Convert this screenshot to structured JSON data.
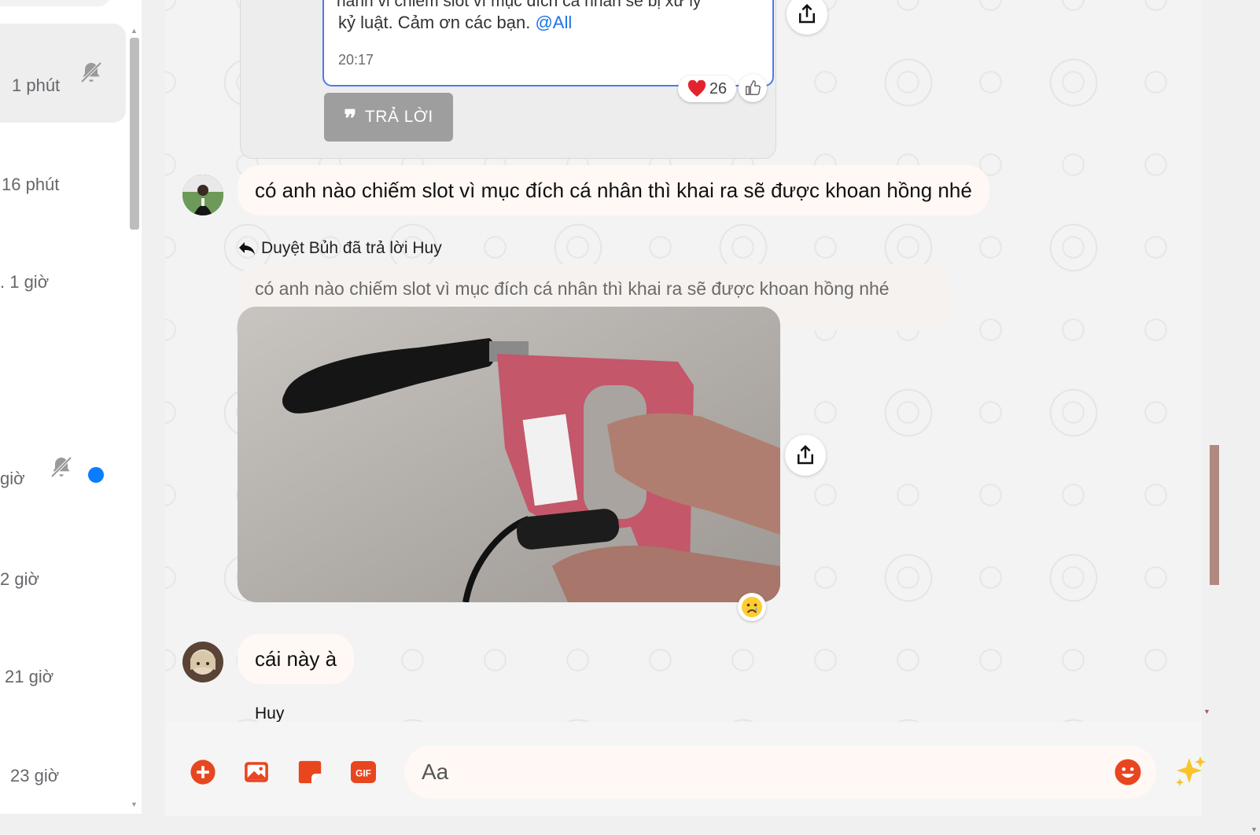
{
  "sidebar": {
    "conversations": [
      {
        "time": "1 phút",
        "muted": true,
        "unread": false,
        "active": true
      },
      {
        "time": "16 phút",
        "muted": false,
        "unread": false,
        "active": false
      },
      {
        "time": ". 1 giờ",
        "muted": false,
        "unread": false,
        "active": false
      },
      {
        "time": "giờ",
        "muted": true,
        "unread": true,
        "active": false
      },
      {
        "time": "2 giờ",
        "muted": false,
        "unread": false,
        "active": false
      },
      {
        "time": "21 giờ",
        "muted": false,
        "unread": false,
        "active": false
      },
      {
        "time": "23 giờ",
        "muted": false,
        "unread": false,
        "active": false
      }
    ]
  },
  "announcement": {
    "cut_line": "hành vi chiếm slot vì mục đích cá nhân sẽ bị xử lý",
    "text": "kỷ luật. Cảm ơn các bạn.",
    "mention": "@All",
    "time": "20:17",
    "reaction_count": "26",
    "reply_label": "TRẢ LỜI"
  },
  "messages": {
    "msg1": {
      "text": "có anh nào chiếm slot vì mục đích cá nhân thì khai ra sẽ được khoan hồng nhé"
    },
    "reply": {
      "header": "Duyệt Bủh đã trả lời Huy",
      "quoted": "có anh nào chiếm slot vì mục đích cá nhân thì khai ra sẽ được khoan hồng nhé"
    },
    "msg3": {
      "text": "cái này à",
      "sender": "Huy"
    }
  },
  "composer": {
    "placeholder": "Aa",
    "gif_label": "GIF"
  },
  "colors": {
    "accent": "#e8461f",
    "mention": "#1a73e8",
    "unread_dot": "#0a7cff"
  }
}
